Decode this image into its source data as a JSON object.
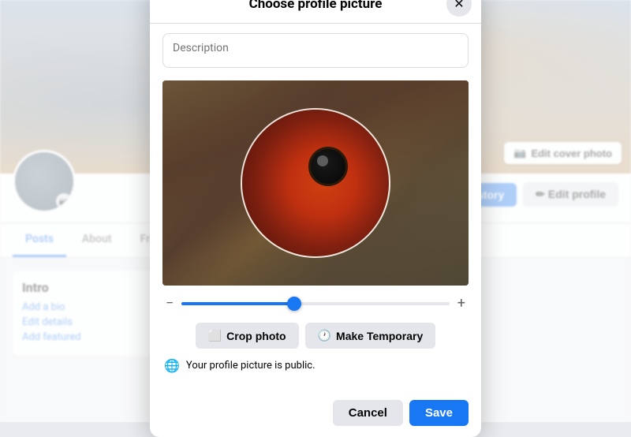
{
  "modal": {
    "title": "Choose profile picture",
    "close_label": "×",
    "description_placeholder": "Description",
    "slider_value": 42,
    "slider_min_icon": "−",
    "slider_max_icon": "+",
    "crop_photo_label": "Crop photo",
    "make_temporary_label": "Make Temporary",
    "privacy_text": "Your profile picture is public.",
    "privacy_icon": "🌐",
    "cancel_label": "Cancel",
    "save_label": "Save"
  },
  "background": {
    "edit_cover_label": "Edit cover photo",
    "camera_icon": "📷",
    "nav_items": [
      "Posts",
      "About",
      "Friends"
    ],
    "intro_title": "Intro",
    "add_bio": "Add a bio",
    "edit_details": "Edit details",
    "add_featured": "Add featured",
    "story_label": "+ Add to story",
    "edit_profile_label": "✏ Edit profile"
  }
}
